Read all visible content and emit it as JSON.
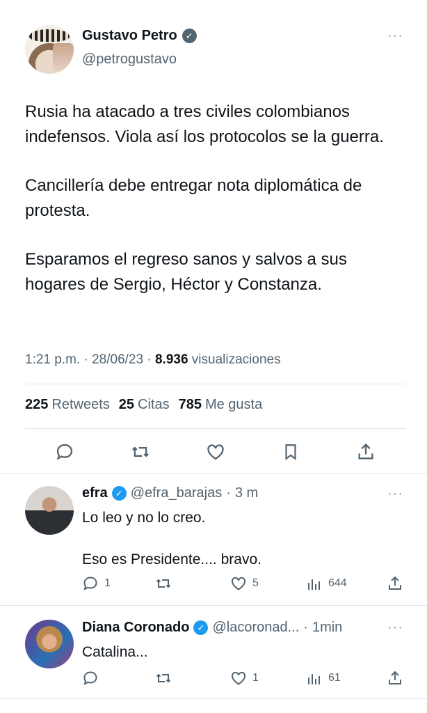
{
  "tweet": {
    "author_name": "Gustavo Petro",
    "author_handle": "@petrogustavo",
    "more_label": "···",
    "paragraphs": [
      "Rusia ha atacado a tres civiles colombianos indefensos. Viola así los protocolos se la guerra.",
      "Cancillería debe entregar nota diplomática de protesta.",
      "Esparamos el regreso sanos y salvos a sus hogares de Sergio, Héctor y Constanza."
    ],
    "time": "1:21 p.m.",
    "date": "28/06/23",
    "views_count": "8.936",
    "views_label": "visualizaciones",
    "separator": "·",
    "retweets_count": "225",
    "retweets_label": "Retweets",
    "quotes_count": "25",
    "quotes_label": "Citas",
    "likes_count": "785",
    "likes_label": "Me gusta",
    "action_icons": [
      "reply-icon",
      "retweet-icon",
      "like-icon",
      "bookmark-icon",
      "share-icon"
    ]
  },
  "replies": [
    {
      "name": "efra",
      "handle": "@efra_barajas",
      "time": "3 m",
      "text": "Lo leo y no lo creo.\n\nEso es Presidente.... bravo.",
      "reply_count": "1",
      "retweet_count": "",
      "like_count": "5",
      "view_count": "644"
    },
    {
      "name": "Diana Coronado",
      "handle": "@lacoronad...",
      "time": "1min",
      "text": "Catalina...",
      "reply_count": "",
      "retweet_count": "",
      "like_count": "1",
      "view_count": "61"
    }
  ],
  "colors": {
    "text_primary": "#0f1419",
    "text_secondary": "#536471",
    "divider": "#e1e6ea",
    "verified_gray": "#536471",
    "verified_blue": "#1d9bf0"
  }
}
